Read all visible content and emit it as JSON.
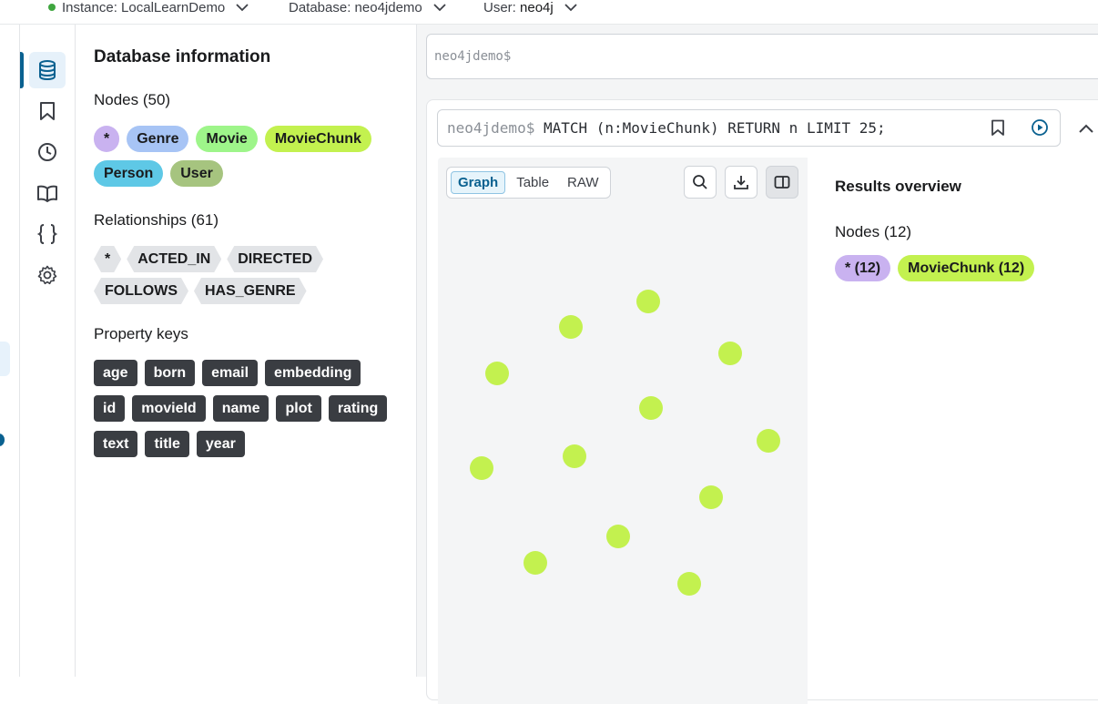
{
  "topbar": {
    "instance_label": "Instance: LocalLearnDemo",
    "database_label": "Database: neo4jdemo",
    "user_prefix": "User: ",
    "user_name": "neo4j",
    "status_color": "#3fa63f"
  },
  "rail": {
    "items": [
      "database-icon",
      "bookmark-icon",
      "history-icon",
      "book-icon",
      "braces-icon",
      "gear-icon"
    ],
    "active": "database-icon"
  },
  "db_panel": {
    "title": "Database information",
    "nodes_title": "Nodes (50)",
    "node_labels": [
      {
        "label": "*",
        "color": "#c9b2f0"
      },
      {
        "label": "Genre",
        "color": "#a7c4f5"
      },
      {
        "label": "Movie",
        "color": "#9ef58a"
      },
      {
        "label": "MovieChunk",
        "color": "#c3f14f"
      },
      {
        "label": "Person",
        "color": "#5ec8e6"
      },
      {
        "label": "User",
        "color": "#a6c47f"
      }
    ],
    "relationships_title": "Relationships (61)",
    "relationship_types": [
      "*",
      "ACTED_IN",
      "DIRECTED",
      "FOLLOWS",
      "HAS_GENRE"
    ],
    "property_keys_title": "Property keys",
    "property_keys": [
      "age",
      "born",
      "email",
      "embedding",
      "id",
      "movieId",
      "name",
      "plot",
      "rating",
      "text",
      "title",
      "year"
    ]
  },
  "editor": {
    "prompt": "neo4jdemo$"
  },
  "result": {
    "prompt": "neo4jdemo$",
    "query": " MATCH (n:MovieChunk) RETURN n LIMIT 25;",
    "tabs": [
      "Graph",
      "Table",
      "RAW"
    ],
    "active_tab": "Graph",
    "node_color": "#c3f14f",
    "overview": {
      "title": "Results overview",
      "nodes_title": "Nodes (12)",
      "chips": [
        {
          "label": "* (12)",
          "color": "#c9b2f0"
        },
        {
          "label": "MovieChunk (12)",
          "color": "#c3f14f"
        }
      ]
    }
  }
}
